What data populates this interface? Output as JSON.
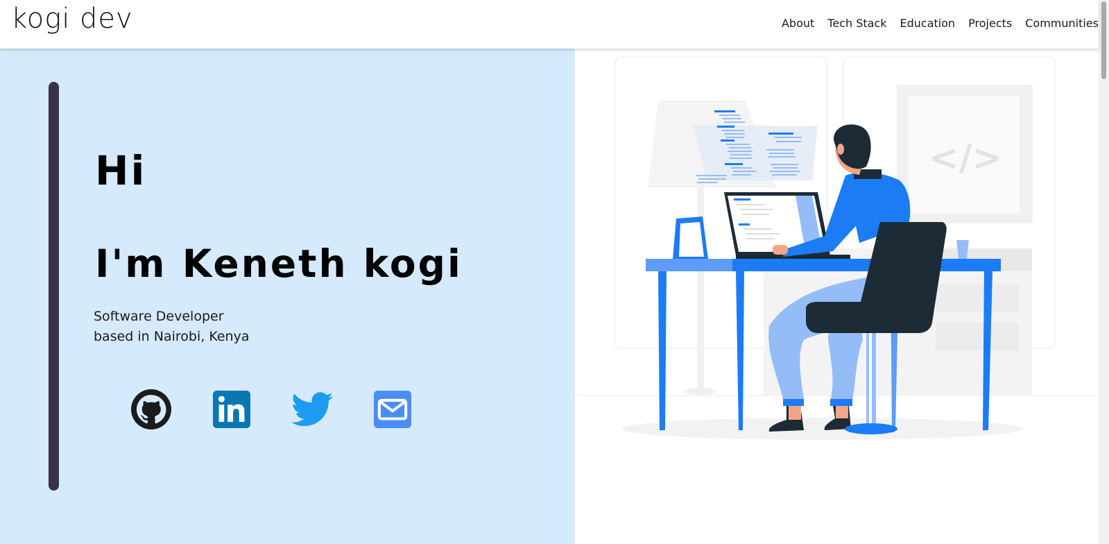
{
  "nav": {
    "brand": "kogi dev",
    "links": [
      "About",
      "Tech Stack",
      "Education",
      "Projects",
      "Communities"
    ]
  },
  "hero": {
    "greeting": "Hi",
    "intro": "I'm Keneth kogi",
    "tagline_line1": "Software Developer",
    "tagline_line2": "based in Nairobi, Kenya",
    "socials": [
      {
        "icon": "github-icon",
        "color": "#1b1b1b"
      },
      {
        "icon": "linkedin-icon",
        "color": "#0a77b5"
      },
      {
        "icon": "twitter-icon",
        "color": "#1d9bf0"
      },
      {
        "icon": "email-icon",
        "color": "#4a8ef5"
      }
    ],
    "illustration": {
      "code_symbol": "</>",
      "colors": {
        "primary": "#1b7cf5",
        "light": "#94bdf8",
        "dark": "#1c2b35",
        "skin": "#f4a489"
      }
    }
  },
  "colors": {
    "hero_bg": "#d5eafc",
    "accent_bar": "#3b3148"
  }
}
